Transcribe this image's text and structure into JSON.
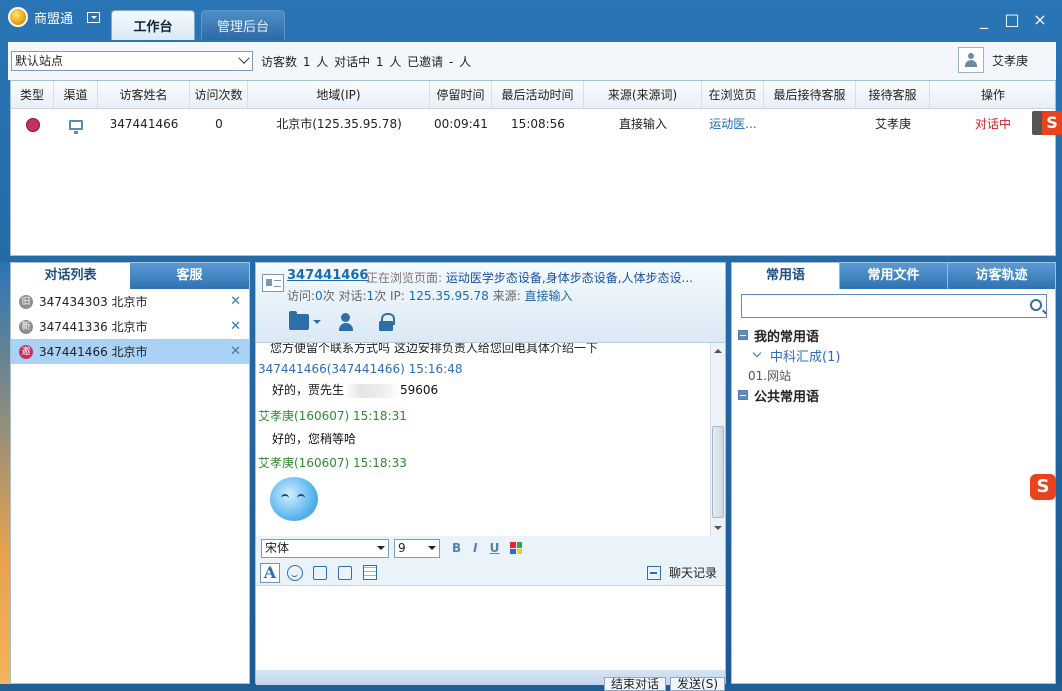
{
  "app": {
    "title": "商盟通",
    "tabs": [
      "工作台",
      "管理后台"
    ],
    "window_buttons": [
      "_",
      "□",
      "×"
    ]
  },
  "toolbar": {
    "site_select": "默认站点",
    "stats": "访客数 1 人   对话中 1 人   已邀请 - 人",
    "username": "艾孝庚"
  },
  "visitor_table": {
    "columns": [
      "类型",
      "渠道",
      "访客姓名",
      "访问次数",
      "地域(IP)",
      "停留时间",
      "最后活动时间",
      "来源(来源词)",
      "在浏览页",
      "最后接待客服",
      "接待客服",
      "操作"
    ],
    "row": {
      "name": "347441466",
      "visits": "0",
      "region": "北京市(125.35.95.78)",
      "stay": "00:09:41",
      "last_active": "15:08:56",
      "source": "直接输入",
      "page": "运动医...",
      "last_agent": "",
      "agent": "艾孝庚",
      "action": "对话中"
    }
  },
  "left_panel": {
    "tabs": [
      "对话列表",
      "客服"
    ],
    "conversations": [
      {
        "badge": "旧",
        "id": "347434303",
        "city": "北京市"
      },
      {
        "badge": "新",
        "id": "347441336",
        "city": "北京市"
      },
      {
        "badge": "邀",
        "id": "347441466",
        "city": "北京市"
      }
    ]
  },
  "chat": {
    "visitor_name": "347441466",
    "browsing_label": "正在浏览页面:",
    "browsing_page": "运动医学步态设备,身体步态设备,人体步态设...",
    "meta_visit_label": "访问:",
    "meta_visit": "0",
    "meta_times1": "次 对话:",
    "meta_chat": "1",
    "meta_times2": "次 IP:",
    "meta_ip": "125.35.95.78",
    "meta_source_label": "来源:",
    "meta_source": "直接输入",
    "messages": [
      {
        "text": "您方便留个联系方式吗 这边安排负责人给您回电具体介绍一下"
      },
      {
        "head": "347441466(347441466)  15:16:48",
        "text_prefix": "好的，贾先生",
        "text_suffix": "59606"
      },
      {
        "head": "艾孝庚(160607)  15:18:31",
        "text": "好的，您稍等哈"
      },
      {
        "head": "艾孝庚(160607)  15:18:33"
      }
    ],
    "font": "宋体",
    "font_size": "9",
    "format_buttons": [
      "B",
      "I",
      "U"
    ],
    "history_label": "聊天记录",
    "send_buttons": [
      "结束对话",
      "发送(S)"
    ]
  },
  "right_panel": {
    "tabs": [
      "常用语",
      "常用文件",
      "访客轨迹"
    ],
    "search_placeholder": "",
    "tree": {
      "my_phrases": "我的常用语",
      "group": "中科汇成(1)",
      "leaf": "01.网站",
      "public_phrases": "公共常用语"
    }
  },
  "ime_letter": "S"
}
